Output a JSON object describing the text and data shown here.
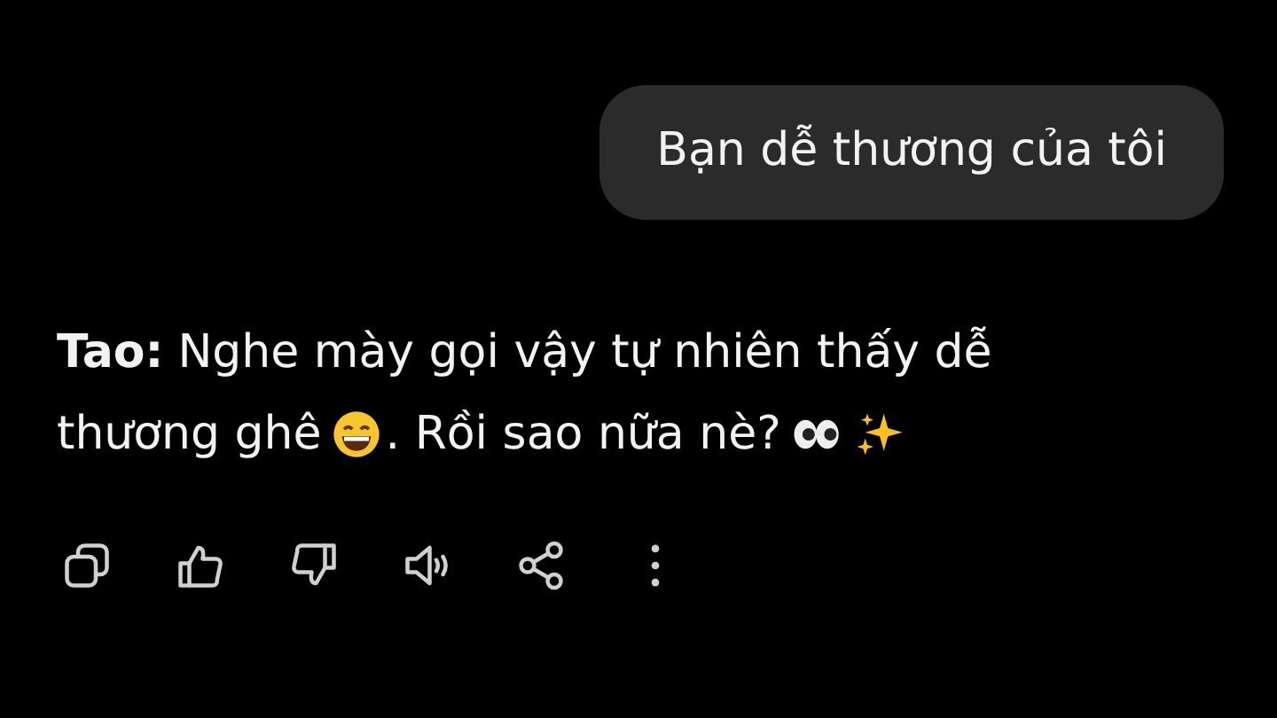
{
  "user_message": {
    "text": "Bạn dễ thương của tôi"
  },
  "reply": {
    "lines": [
      [
        {
          "kind": "speaker",
          "text": "Tao:"
        },
        {
          "kind": "text",
          "text": "Nghe mày gọi vậy tự nhiên thấy dễ"
        }
      ],
      [
        {
          "kind": "text",
          "text": "thương ghê"
        },
        {
          "kind": "grin"
        },
        {
          "kind": "text",
          "text": ". Rồi sao nữa nè?"
        },
        {
          "kind": "eyes"
        },
        {
          "kind": "sparkles"
        }
      ]
    ]
  },
  "actions": [
    {
      "kind": "copy"
    },
    {
      "kind": "like"
    },
    {
      "kind": "dislike"
    },
    {
      "kind": "speak"
    },
    {
      "kind": "share"
    },
    {
      "kind": "more"
    }
  ]
}
